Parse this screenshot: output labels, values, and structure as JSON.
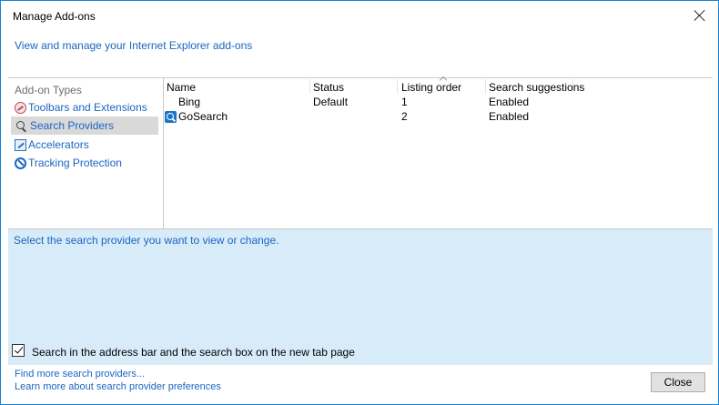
{
  "window": {
    "title": "Manage Add-ons"
  },
  "header": {
    "subtitle": "View and manage your Internet Explorer add-ons"
  },
  "sidebar": {
    "heading": "Add-on Types",
    "items": [
      {
        "label": "Toolbars and Extensions",
        "icon": "toolbars-extensions-icon"
      },
      {
        "label": "Search Providers",
        "icon": "search-icon",
        "selected": true
      },
      {
        "label": "Accelerators",
        "icon": "accelerators-icon"
      },
      {
        "label": "Tracking Protection",
        "icon": "tracking-protection-icon"
      }
    ]
  },
  "table": {
    "columns": [
      "Name",
      "Status",
      "Listing order",
      "Search suggestions"
    ],
    "rows": [
      {
        "name": "Bing",
        "status": "Default",
        "order": "1",
        "suggestions": "Enabled"
      },
      {
        "name": "GoSearch",
        "status": "",
        "order": "2",
        "suggestions": "Enabled",
        "icon": "gosearch-icon"
      }
    ]
  },
  "details": {
    "prompt": "Select the search provider you want to view or change.",
    "checkbox_label": "Search in the address bar and the search box on the new tab page",
    "checkbox_checked": true
  },
  "footer": {
    "link_find": "Find more search providers...",
    "link_learn": "Learn more about search provider preferences",
    "close_label": "Close"
  },
  "colors": {
    "link": "#1a66c2",
    "details_bg": "#d8ebf8",
    "selection": "#d9d9d9"
  }
}
